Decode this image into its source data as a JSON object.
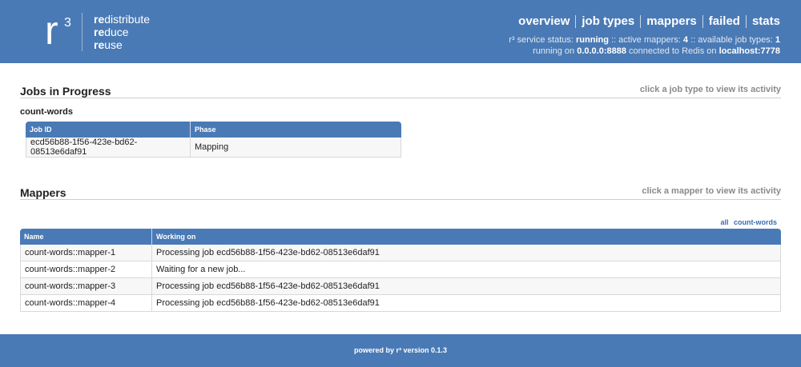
{
  "logo": {
    "letter": "r",
    "sup": "3",
    "tagline": [
      {
        "bold": "re",
        "rest": "distribute"
      },
      {
        "bold": "re",
        "rest": "duce"
      },
      {
        "bold": "re",
        "rest": "use"
      }
    ]
  },
  "nav": [
    "overview",
    "job types",
    "mappers",
    "failed",
    "stats"
  ],
  "status": {
    "prefix": "r³ service status:",
    "state": "running",
    "mappers_label": ":: active mappers:",
    "mappers": "4",
    "jobtypes_label": ":: available job types:",
    "jobtypes": "1",
    "running_on_label": "running on",
    "address": "0.0.0.0:8888",
    "redis_label": "connected to Redis on",
    "redis": "localhost:7778"
  },
  "jobs": {
    "title": "Jobs in Progress",
    "hint": "click a job type to view its activity",
    "job_type": "count-words",
    "headers": [
      "Job ID",
      "Phase"
    ],
    "rows": [
      [
        "ecd56b88-1f56-423e-bd62-08513e6daf91",
        "Mapping"
      ]
    ]
  },
  "mappers": {
    "title": "Mappers",
    "hint": "click a mapper to view its activity",
    "filters": [
      "all",
      "count-words"
    ],
    "headers": [
      "Name",
      "Working on"
    ],
    "rows": [
      [
        "count-words::mapper-1",
        "Processing job ecd56b88-1f56-423e-bd62-08513e6daf91"
      ],
      [
        "count-words::mapper-2",
        "Waiting for a new job..."
      ],
      [
        "count-words::mapper-3",
        "Processing job ecd56b88-1f56-423e-bd62-08513e6daf91"
      ],
      [
        "count-words::mapper-4",
        "Processing job ecd56b88-1f56-423e-bd62-08513e6daf91"
      ]
    ]
  },
  "footer": "powered by r³ version 0.1.3",
  "colors": {
    "brand": "#4a7ab5",
    "link": "#3a6eae"
  }
}
